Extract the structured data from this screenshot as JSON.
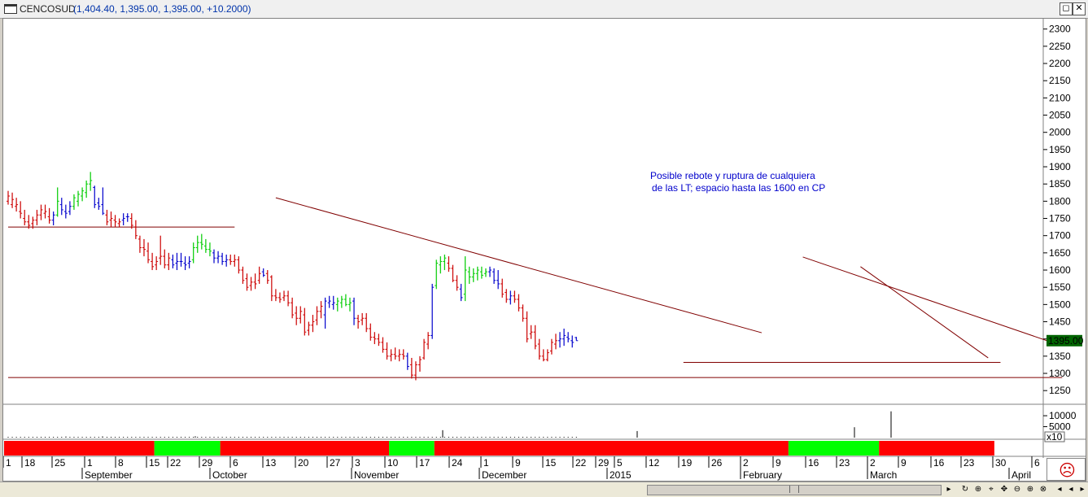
{
  "window": {
    "symbol": "CENCOSUD",
    "values": "(1,404.40, 1,395.00, 1,395.00, +10.2000)",
    "btn_restore": "◻",
    "btn_close": "✕"
  },
  "price_label": "1395.00",
  "volume_multiplier": "x10",
  "colors": {
    "up": "#00cc00",
    "down": "#cc0000",
    "neutral": "#0000cc",
    "trend": "#800000",
    "band_red": "#ff0000",
    "band_green": "#00ff00"
  },
  "annotation": [
    "Posible rebote y ruptura de cualquiera",
    "de las LT; espacio hasta las 1600 en CP"
  ],
  "chart_data": {
    "type": "bar",
    "description_ohlc": true,
    "y_ticks": [
      1250,
      1300,
      1350,
      1400,
      1450,
      1500,
      1550,
      1600,
      1650,
      1700,
      1750,
      1800,
      1850,
      1900,
      1950,
      2000,
      2050,
      2100,
      2150,
      2200,
      2250,
      2300
    ],
    "ylim": [
      1215,
      2330
    ],
    "volume_ticks": [
      5000,
      10000
    ],
    "x_day_labels": [
      "1",
      "18",
      "25",
      "1",
      "8",
      "15",
      "22",
      "29",
      "6",
      "13",
      "20",
      "27",
      "3",
      "10",
      "17",
      "24",
      "1",
      "9",
      "15",
      "22",
      "29",
      "5",
      "12",
      "19",
      "26",
      "2",
      "9",
      "16",
      "23",
      "2",
      "9",
      "16",
      "23",
      "30",
      "6"
    ],
    "x_month_labels": [
      "September",
      "October",
      "November",
      "December",
      "2015",
      "February",
      "March",
      "April"
    ],
    "bars": [
      [
        1800,
        1830,
        1790,
        1815,
        "d"
      ],
      [
        1790,
        1825,
        1780,
        1805,
        "d"
      ],
      [
        1785,
        1810,
        1770,
        1790,
        "d"
      ],
      [
        1770,
        1800,
        1750,
        1765,
        "d"
      ],
      [
        1750,
        1775,
        1730,
        1740,
        "d"
      ],
      [
        1740,
        1760,
        1720,
        1730,
        "d"
      ],
      [
        1735,
        1755,
        1720,
        1745,
        "d"
      ],
      [
        1745,
        1775,
        1730,
        1760,
        "d"
      ],
      [
        1760,
        1790,
        1745,
        1775,
        "d"
      ],
      [
        1765,
        1790,
        1750,
        1770,
        "d"
      ],
      [
        1755,
        1780,
        1735,
        1745,
        "d"
      ],
      [
        1745,
        1770,
        1730,
        1760,
        "n"
      ],
      [
        1760,
        1840,
        1755,
        1800,
        "u"
      ],
      [
        1790,
        1810,
        1760,
        1775,
        "n"
      ],
      [
        1770,
        1790,
        1750,
        1765,
        "n"
      ],
      [
        1770,
        1800,
        1760,
        1785,
        "n"
      ],
      [
        1785,
        1820,
        1775,
        1810,
        "u"
      ],
      [
        1800,
        1830,
        1785,
        1820,
        "u"
      ],
      [
        1815,
        1840,
        1800,
        1830,
        "u"
      ],
      [
        1825,
        1860,
        1810,
        1850,
        "u"
      ],
      [
        1850,
        1885,
        1830,
        1860,
        "u"
      ],
      [
        1840,
        1845,
        1780,
        1790,
        "n"
      ],
      [
        1795,
        1810,
        1775,
        1785,
        "n"
      ],
      [
        1790,
        1840,
        1760,
        1765,
        "n"
      ],
      [
        1760,
        1775,
        1730,
        1740,
        "d"
      ],
      [
        1745,
        1770,
        1725,
        1750,
        "d"
      ],
      [
        1745,
        1760,
        1725,
        1740,
        "d"
      ],
      [
        1735,
        1750,
        1725,
        1740,
        "d"
      ],
      [
        1745,
        1765,
        1730,
        1750,
        "n"
      ],
      [
        1755,
        1765,
        1740,
        1755,
        "n"
      ],
      [
        1750,
        1765,
        1720,
        1730,
        "d"
      ],
      [
        1725,
        1745,
        1690,
        1700,
        "d"
      ],
      [
        1690,
        1700,
        1650,
        1665,
        "d"
      ],
      [
        1665,
        1690,
        1640,
        1660,
        "d"
      ],
      [
        1655,
        1680,
        1620,
        1630,
        "d"
      ],
      [
        1625,
        1650,
        1600,
        1610,
        "d"
      ],
      [
        1615,
        1640,
        1600,
        1625,
        "d"
      ],
      [
        1635,
        1700,
        1615,
        1640,
        "d"
      ],
      [
        1640,
        1660,
        1605,
        1615,
        "d"
      ],
      [
        1615,
        1650,
        1600,
        1635,
        "d"
      ],
      [
        1630,
        1645,
        1605,
        1615,
        "n"
      ],
      [
        1620,
        1650,
        1600,
        1625,
        "n"
      ],
      [
        1625,
        1650,
        1610,
        1625,
        "n"
      ],
      [
        1620,
        1640,
        1600,
        1615,
        "n"
      ],
      [
        1620,
        1640,
        1605,
        1625,
        "n"
      ],
      [
        1630,
        1680,
        1620,
        1665,
        "u"
      ],
      [
        1665,
        1700,
        1650,
        1680,
        "u"
      ],
      [
        1680,
        1705,
        1660,
        1675,
        "u"
      ],
      [
        1670,
        1690,
        1650,
        1660,
        "u"
      ],
      [
        1660,
        1680,
        1640,
        1655,
        "u"
      ],
      [
        1650,
        1660,
        1620,
        1635,
        "n"
      ],
      [
        1635,
        1655,
        1620,
        1640,
        "n"
      ],
      [
        1640,
        1650,
        1615,
        1625,
        "n"
      ],
      [
        1625,
        1645,
        1610,
        1630,
        "n"
      ],
      [
        1630,
        1645,
        1615,
        1625,
        "d"
      ],
      [
        1625,
        1645,
        1610,
        1630,
        "d"
      ],
      [
        1630,
        1640,
        1590,
        1600,
        "d"
      ],
      [
        1600,
        1610,
        1560,
        1570,
        "d"
      ],
      [
        1575,
        1590,
        1540,
        1550,
        "d"
      ],
      [
        1555,
        1580,
        1540,
        1565,
        "d"
      ],
      [
        1565,
        1590,
        1545,
        1560,
        "d"
      ],
      [
        1570,
        1610,
        1560,
        1590,
        "d"
      ],
      [
        1595,
        1605,
        1580,
        1585,
        "n"
      ],
      [
        1590,
        1600,
        1560,
        1570,
        "d"
      ],
      [
        1580,
        1585,
        1510,
        1525,
        "d"
      ],
      [
        1525,
        1545,
        1510,
        1520,
        "d"
      ],
      [
        1520,
        1535,
        1505,
        1515,
        "d"
      ],
      [
        1520,
        1540,
        1510,
        1525,
        "d"
      ],
      [
        1525,
        1540,
        1495,
        1505,
        "d"
      ],
      [
        1505,
        1520,
        1460,
        1470,
        "d"
      ],
      [
        1475,
        1495,
        1440,
        1460,
        "d"
      ],
      [
        1460,
        1495,
        1445,
        1480,
        "d"
      ],
      [
        1470,
        1490,
        1410,
        1420,
        "d"
      ],
      [
        1425,
        1450,
        1410,
        1440,
        "d"
      ],
      [
        1440,
        1470,
        1420,
        1450,
        "d"
      ],
      [
        1455,
        1495,
        1440,
        1480,
        "d"
      ],
      [
        1480,
        1510,
        1460,
        1495,
        "d"
      ],
      [
        1470,
        1520,
        1430,
        1510,
        "n"
      ],
      [
        1505,
        1525,
        1490,
        1510,
        "n"
      ],
      [
        1500,
        1525,
        1485,
        1505,
        "n"
      ],
      [
        1500,
        1520,
        1480,
        1510,
        "u"
      ],
      [
        1505,
        1525,
        1490,
        1515,
        "u"
      ],
      [
        1515,
        1530,
        1495,
        1500,
        "u"
      ],
      [
        1500,
        1520,
        1480,
        1505,
        "u"
      ],
      [
        1510,
        1520,
        1440,
        1460,
        "n"
      ],
      [
        1460,
        1470,
        1430,
        1450,
        "d"
      ],
      [
        1455,
        1475,
        1440,
        1460,
        "d"
      ],
      [
        1460,
        1475,
        1420,
        1430,
        "d"
      ],
      [
        1430,
        1445,
        1395,
        1405,
        "d"
      ],
      [
        1405,
        1420,
        1385,
        1400,
        "d"
      ],
      [
        1400,
        1415,
        1380,
        1390,
        "d"
      ],
      [
        1390,
        1405,
        1360,
        1370,
        "d"
      ],
      [
        1370,
        1390,
        1340,
        1350,
        "d"
      ],
      [
        1350,
        1370,
        1335,
        1355,
        "d"
      ],
      [
        1355,
        1375,
        1340,
        1350,
        "d"
      ],
      [
        1350,
        1370,
        1335,
        1355,
        "d"
      ],
      [
        1355,
        1370,
        1340,
        1350,
        "d"
      ],
      [
        1350,
        1360,
        1310,
        1320,
        "n"
      ],
      [
        1325,
        1345,
        1285,
        1295,
        "d"
      ],
      [
        1295,
        1335,
        1280,
        1325,
        "d"
      ],
      [
        1325,
        1350,
        1305,
        1340,
        "d"
      ],
      [
        1345,
        1400,
        1340,
        1390,
        "d"
      ],
      [
        1385,
        1420,
        1370,
        1410,
        "d"
      ],
      [
        1410,
        1560,
        1400,
        1550,
        "n"
      ],
      [
        1555,
        1630,
        1545,
        1620,
        "u"
      ],
      [
        1615,
        1640,
        1590,
        1625,
        "u"
      ],
      [
        1625,
        1645,
        1600,
        1635,
        "u"
      ],
      [
        1620,
        1640,
        1595,
        1605,
        "d"
      ],
      [
        1605,
        1615,
        1565,
        1570,
        "d"
      ],
      [
        1570,
        1585,
        1540,
        1550,
        "d"
      ],
      [
        1545,
        1560,
        1510,
        1520,
        "n"
      ],
      [
        1530,
        1640,
        1510,
        1600,
        "u"
      ],
      [
        1595,
        1610,
        1560,
        1580,
        "u"
      ],
      [
        1580,
        1605,
        1565,
        1590,
        "u"
      ],
      [
        1590,
        1610,
        1570,
        1600,
        "u"
      ],
      [
        1595,
        1610,
        1575,
        1585,
        "u"
      ],
      [
        1590,
        1605,
        1580,
        1595,
        "u"
      ],
      [
        1595,
        1610,
        1580,
        1600,
        "n"
      ],
      [
        1595,
        1605,
        1560,
        1570,
        "n"
      ],
      [
        1570,
        1600,
        1545,
        1560,
        "n"
      ],
      [
        1560,
        1575,
        1520,
        1530,
        "d"
      ],
      [
        1535,
        1545,
        1505,
        1515,
        "d"
      ],
      [
        1515,
        1540,
        1500,
        1525,
        "n"
      ],
      [
        1525,
        1540,
        1505,
        1515,
        "d"
      ],
      [
        1515,
        1530,
        1480,
        1490,
        "d"
      ],
      [
        1490,
        1500,
        1450,
        1460,
        "d"
      ],
      [
        1460,
        1480,
        1390,
        1400,
        "d"
      ],
      [
        1415,
        1440,
        1400,
        1420,
        "d"
      ],
      [
        1420,
        1440,
        1370,
        1380,
        "d"
      ],
      [
        1385,
        1400,
        1340,
        1350,
        "d"
      ],
      [
        1350,
        1370,
        1335,
        1340,
        "d"
      ],
      [
        1340,
        1370,
        1335,
        1360,
        "d"
      ],
      [
        1365,
        1400,
        1355,
        1390,
        "d"
      ],
      [
        1385,
        1415,
        1370,
        1395,
        "d"
      ],
      [
        1395,
        1420,
        1375,
        1400,
        "n"
      ],
      [
        1400,
        1430,
        1380,
        1410,
        "n"
      ],
      [
        1405,
        1420,
        1390,
        1400,
        "n"
      ],
      [
        1395,
        1410,
        1375,
        1390,
        "n"
      ],
      [
        1404,
        1406,
        1395,
        1395,
        "n"
      ]
    ],
    "volume": [
      [
        77,
        10
      ],
      [
        122,
        11
      ],
      [
        236,
        12
      ],
      [
        540,
        68
      ],
      [
        779,
        60
      ],
      [
        1046,
        95
      ],
      [
        1091,
        240
      ]
    ],
    "trendlines": [
      {
        "from": [
          0,
          1725
        ],
        "to": [
          55,
          1725
        ]
      },
      {
        "from": [
          65,
          1810
        ],
        "to": [
          183,
          1418
        ]
      },
      {
        "from": [
          164,
          1332
        ],
        "to": [
          241,
          1332
        ]
      },
      {
        "from": [
          193,
          1638
        ],
        "to": [
          254,
          1388
        ]
      },
      {
        "from": [
          207,
          1610
        ],
        "to": [
          238,
          1345
        ]
      },
      {
        "from": [
          0,
          1288
        ],
        "to": [
          256,
          1288
        ]
      }
    ],
    "bands": [
      [
        "r",
        0,
        36
      ],
      [
        "g",
        36,
        52
      ],
      [
        "r",
        52,
        93
      ],
      [
        "g",
        93,
        104
      ],
      [
        "r",
        104,
        190
      ],
      [
        "g",
        190,
        212
      ],
      [
        "r",
        212,
        240
      ]
    ]
  }
}
